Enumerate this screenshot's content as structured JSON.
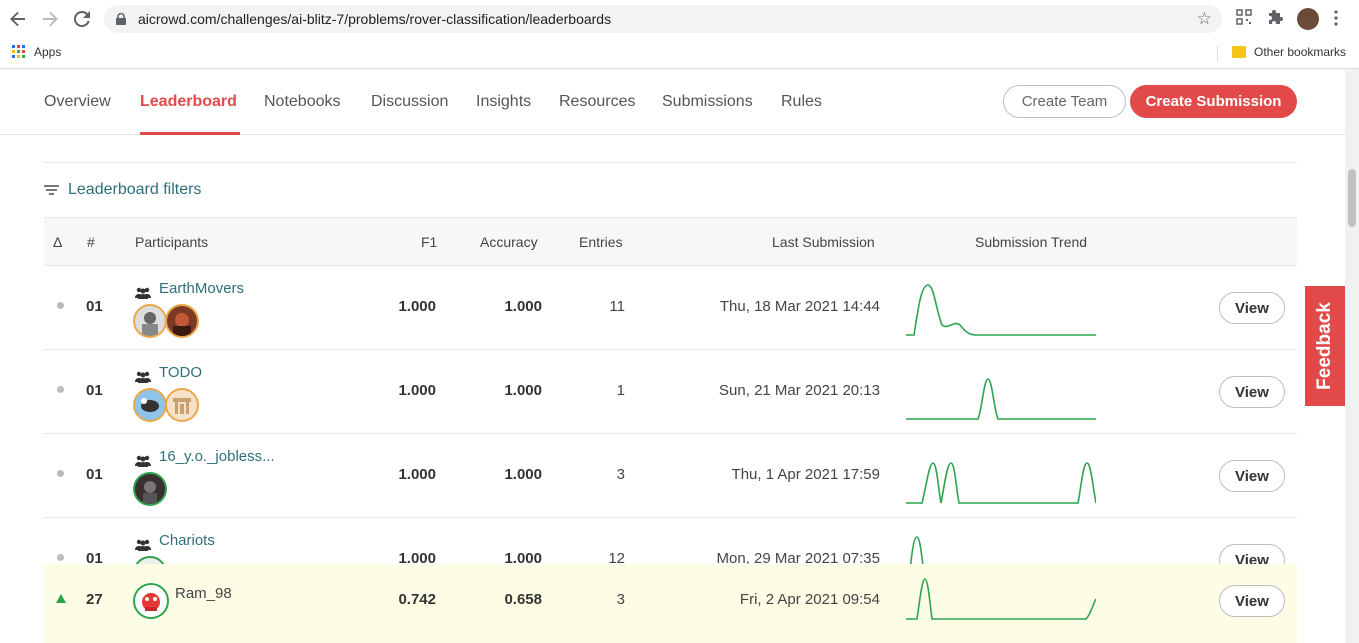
{
  "browser": {
    "url": "aicrowd.com/challenges/ai-blitz-7/problems/rover-classification/leaderboards",
    "bookmarks": {
      "apps_label": "Apps",
      "other_label": "Other bookmarks"
    }
  },
  "subnav": {
    "tabs": [
      {
        "label": "Overview",
        "active": false
      },
      {
        "label": "Leaderboard",
        "active": true
      },
      {
        "label": "Notebooks",
        "active": false
      },
      {
        "label": "Discussion",
        "active": false
      },
      {
        "label": "Insights",
        "active": false
      },
      {
        "label": "Resources",
        "active": false
      },
      {
        "label": "Submissions",
        "active": false
      },
      {
        "label": "Rules",
        "active": false
      }
    ],
    "create_team_label": "Create Team",
    "create_submission_label": "Create Submission"
  },
  "filters": {
    "label": "Leaderboard filters"
  },
  "table": {
    "headers": {
      "delta": "Δ",
      "rank": "#",
      "participants": "Participants",
      "f1": "F1",
      "accuracy": "Accuracy",
      "entries": "Entries",
      "last_submission": "Last Submission",
      "trend": "Submission Trend"
    },
    "rows": [
      {
        "change": "none",
        "rank": "01",
        "name": "EarthMovers",
        "f1": "1.000",
        "accuracy": "1.000",
        "entries": "11",
        "last_submission": "Thu, 18 Mar 2021 14:44",
        "view_label": "View"
      },
      {
        "change": "none",
        "rank": "01",
        "name": "TODO",
        "f1": "1.000",
        "accuracy": "1.000",
        "entries": "1",
        "last_submission": "Sun, 21 Mar 2021 20:13",
        "view_label": "View"
      },
      {
        "change": "none",
        "rank": "01",
        "name": "16_y.o._jobless...",
        "f1": "1.000",
        "accuracy": "1.000",
        "entries": "3",
        "last_submission": "Thu, 1 Apr 2021 17:59",
        "view_label": "View"
      },
      {
        "change": "none",
        "rank": "01",
        "name": "Chariots",
        "f1": "1.000",
        "accuracy": "1.000",
        "entries": "12",
        "last_submission": "Mon, 29 Mar 2021 07:35",
        "view_label": "View"
      }
    ],
    "current_user_row": {
      "change": "up",
      "rank": "27",
      "name": "Ram_98",
      "f1": "0.742",
      "accuracy": "0.658",
      "entries": "3",
      "last_submission": "Fri, 2 Apr 2021 09:54",
      "view_label": "View"
    }
  },
  "feedback_label": "Feedback",
  "colors": {
    "accent": "#e24a4a",
    "link": "#2f6f7a",
    "trend": "#2ea44f",
    "highlight_row": "#fdfde6"
  }
}
